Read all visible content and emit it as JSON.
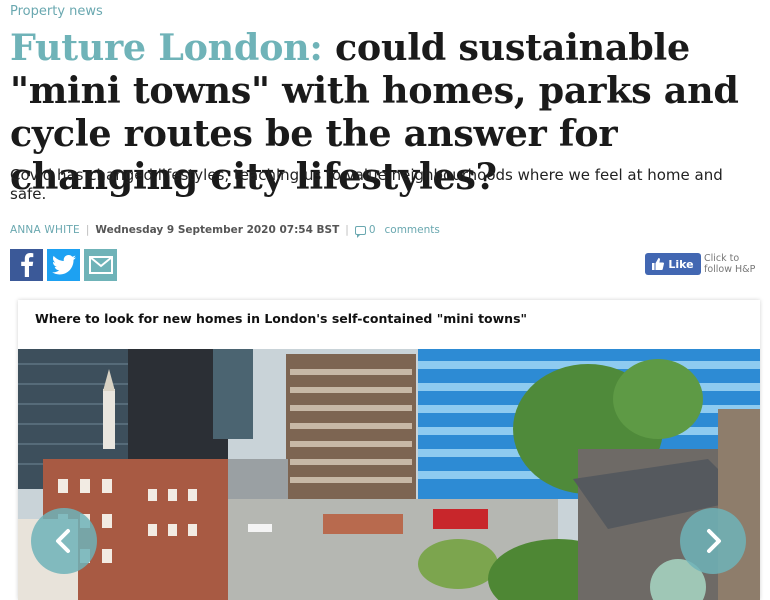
{
  "article": {
    "kicker": "Property news",
    "headline_lead": "Future London:",
    "headline_rest": " could sustainable \"mini towns\" with homes, parks and cycle routes be the answer for changing city lifestyles?",
    "standfirst": "Covid has changed lifestyles, teaching us to value neighbourhoods where we feel at home and safe.",
    "author": "Anna White",
    "separator": "|",
    "date": "Wednesday 9 September 2020 07:54 BST",
    "comment_count": "0",
    "comments_label": "comments"
  },
  "share": {
    "facebook_icon": "facebook-icon",
    "twitter_icon": "twitter-icon",
    "email_icon": "email-icon"
  },
  "follow": {
    "like_label": "Like",
    "hint": "Click to follow H&P"
  },
  "gallery": {
    "title": "Where to look for new homes in London's self-contained \"mini towns\"",
    "prev_icon": "chevron-left-icon",
    "next_icon": "chevron-right-icon"
  },
  "colors": {
    "accent": "#6fb3b8",
    "facebook": "#3b5998",
    "twitter": "#1da1f2",
    "like_button": "#4267b2"
  }
}
